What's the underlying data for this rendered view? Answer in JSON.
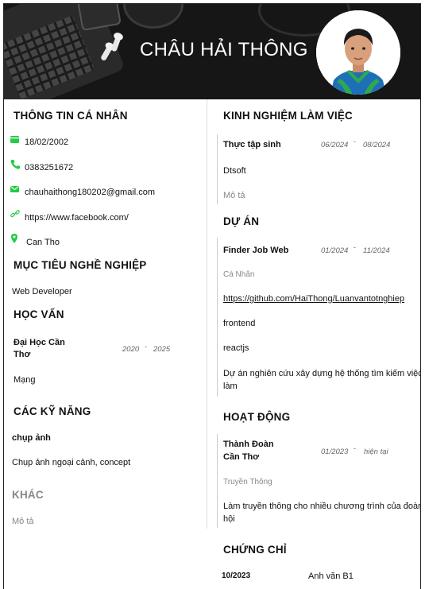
{
  "name": "CHÂU HẢI THÔNG",
  "colors": {
    "header_bg": "#161616",
    "icon_green": "#22cc44"
  },
  "personal": {
    "title": "THÔNG TIN CÁ NHÂN",
    "birthday": "18/02/2002",
    "phone": "0383251672",
    "email": "chauhaithong180202@gmail.com",
    "website": "https://www.facebook.com/",
    "address": "Can Tho"
  },
  "objective": {
    "title": "MỤC TIÊU NGHỀ NGHIỆP",
    "text": "Web Developer"
  },
  "education": {
    "title": "HỌC VẤN",
    "school_line1": "Đại Học Cần",
    "school_line2": "Thơ",
    "start": "2020",
    "end": "2025",
    "major": "Mạng"
  },
  "skills": {
    "title": "CÁC KỸ NĂNG",
    "name": "chụp ảnh",
    "desc": "Chụp ảnh ngoại cảnh, concept"
  },
  "other": {
    "title": "KHÁC",
    "desc": "Mô tả"
  },
  "experience": {
    "title": "KINH NGHIỆM LÀM VIỆC",
    "position": "Thực tập sinh",
    "start": "06/2024",
    "end": "08/2024",
    "company": "Dtsoft",
    "desc": "Mô tả"
  },
  "projects": {
    "title": "DỰ ÁN",
    "name": "Finder Job Web",
    "start": "01/2024",
    "end": "11/2024",
    "role": "Cá Nhân",
    "link": "https://github.com/HaiThong/Luanvantotnghiep",
    "tech1": "frontend",
    "tech2": "reactjs",
    "desc_line1": "Dự án nghiên cứu xây dựng hệ thống tìm kiếm việc",
    "desc_line2": "làm"
  },
  "activities": {
    "title": "HOẠT ĐỘNG",
    "org_line1": "Thành Đoàn",
    "org_line2": "Cần Thơ",
    "start": "01/2023",
    "end": "hiện tại",
    "role": "Truyền Thông",
    "desc_line1": "Làm truyền thông cho nhiều chương trình của đoàn",
    "desc_line2": "hội"
  },
  "certificates": {
    "title": "CHỨNG CHỈ",
    "date": "10/2023",
    "name": "Anh văn B1"
  },
  "icons": [
    "calendar-icon",
    "phone-icon",
    "email-icon",
    "link-icon",
    "location-pin-icon",
    "earbuds-icon"
  ]
}
